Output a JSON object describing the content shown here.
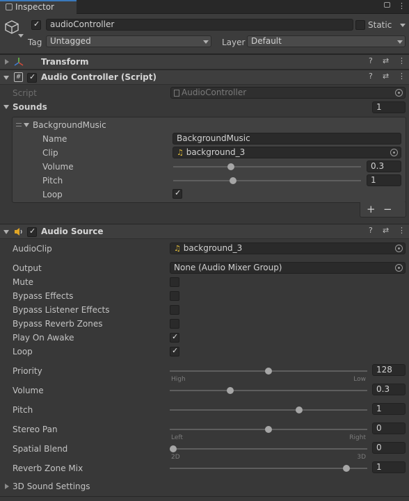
{
  "tab": {
    "label": "Inspector"
  },
  "object": {
    "name": "audioController",
    "static_label": "Static",
    "tag_label": "Tag",
    "tag_value": "Untagged",
    "layer_label": "Layer",
    "layer_value": "Default"
  },
  "transform": {
    "title": "Transform"
  },
  "audio_controller": {
    "title": "Audio Controller (Script)",
    "script_label": "Script",
    "script_value": "AudioController",
    "sounds_label": "Sounds",
    "sounds_count": "1",
    "element": {
      "title": "BackgroundMusic",
      "name_label": "Name",
      "name_value": "BackgroundMusic",
      "clip_label": "Clip",
      "clip_value": "background_3",
      "volume_label": "Volume",
      "volume_value": "0.3",
      "volume_level": 0.3,
      "pitch_label": "Pitch",
      "pitch_value": "1",
      "pitch_level": 0.31,
      "loop_label": "Loop",
      "loop_checked": true
    },
    "add_symbol": "+",
    "remove_symbol": "−"
  },
  "audio_source": {
    "title": "Audio Source",
    "audioclip_label": "AudioClip",
    "audioclip_value": "background_3",
    "output_label": "Output",
    "output_value": "None (Audio Mixer Group)",
    "toggles": [
      {
        "label": "Mute",
        "checked": false
      },
      {
        "label": "Bypass Effects",
        "checked": false
      },
      {
        "label": "Bypass Listener Effects",
        "checked": false
      },
      {
        "label": "Bypass Reverb Zones",
        "checked": false
      },
      {
        "label": "Play On Awake",
        "checked": true
      },
      {
        "label": "Loop",
        "checked": true
      }
    ],
    "sliders": [
      {
        "label": "Priority",
        "value": "128",
        "level": 0.5,
        "left": "High",
        "right": "Low"
      },
      {
        "label": "Volume",
        "value": "0.3",
        "level": 0.3,
        "left": "",
        "right": ""
      },
      {
        "label": "Pitch",
        "value": "1",
        "level": 0.66,
        "left": "",
        "right": ""
      },
      {
        "label": "Stereo Pan",
        "value": "0",
        "level": 0.5,
        "left": "Left",
        "right": "Right"
      },
      {
        "label": "Spatial Blend",
        "value": "0",
        "level": 0.0,
        "left": "2D",
        "right": "3D"
      },
      {
        "label": "Reverb Zone Mix",
        "value": "1",
        "level": 0.91,
        "left": "",
        "right": ""
      }
    ],
    "sound_settings_label": "3D Sound Settings"
  }
}
